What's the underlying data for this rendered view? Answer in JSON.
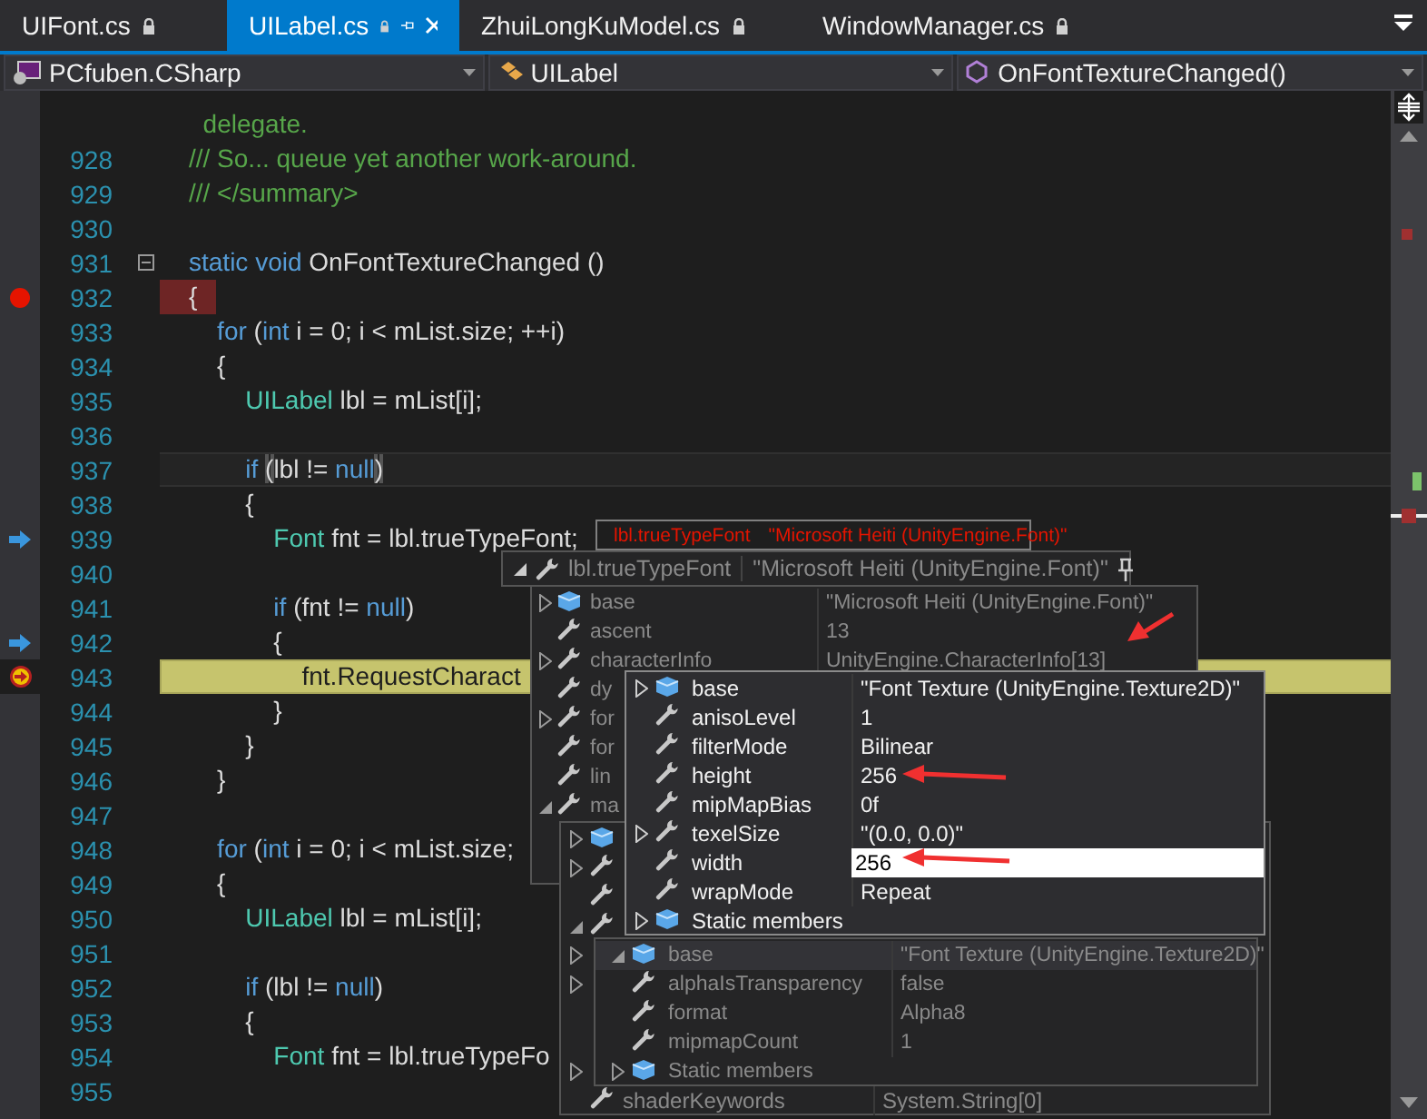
{
  "tabs": [
    {
      "label": "UIFont.cs",
      "selected": false,
      "locked": true
    },
    {
      "label": "UILabel.cs",
      "selected": true,
      "locked": true
    },
    {
      "label": "ZhuiLongKuModel.cs",
      "selected": false,
      "locked": true
    },
    {
      "label": "WindowManager.cs",
      "selected": false,
      "locked": true
    }
  ],
  "nav": {
    "project": "PCfuben.CSharp",
    "type": "UILabel",
    "member": "OnFontTextureChanged()"
  },
  "code_lines": [
    {
      "tokens": [
        {
          "kind": "comment",
          "text": "  delegate."
        }
      ]
    },
    {
      "number": "928",
      "tokens": [
        {
          "kind": "comment",
          "text": "/// So... queue yet another work-around."
        }
      ]
    },
    {
      "number": "929",
      "tokens": [
        {
          "kind": "comment",
          "text": "/// </summary>"
        }
      ]
    },
    {
      "number": "930"
    },
    {
      "number": "931",
      "collapsible": true,
      "tokens": [
        {
          "kind": "keyword",
          "text": "static void "
        },
        {
          "kind": "plain",
          "text": "OnFontTextureChanged ()"
        }
      ]
    },
    {
      "number": "932",
      "breakpoint": true,
      "tokens": [
        {
          "kind": "plain",
          "text": "{"
        }
      ]
    },
    {
      "number": "933",
      "tokens": [
        {
          "kind": "keyword",
          "text": "    for"
        },
        {
          "kind": "plain",
          "text": " ("
        },
        {
          "kind": "keyword",
          "text": "int"
        },
        {
          "kind": "plain",
          "text": " i = 0; i < mList.size; ++i)"
        }
      ]
    },
    {
      "number": "934",
      "tokens": [
        {
          "kind": "plain",
          "text": "    {"
        }
      ]
    },
    {
      "number": "935",
      "tokens": [
        {
          "kind": "type",
          "text": "        UILabel"
        },
        {
          "kind": "plain",
          "text": " lbl = mList[i];"
        }
      ]
    },
    {
      "number": "936"
    },
    {
      "number": "937",
      "caret_line": true,
      "tokens": [
        {
          "kind": "keyword",
          "text": "        if "
        },
        {
          "kind": "match",
          "text": "("
        },
        {
          "kind": "plain",
          "text": "lbl != "
        },
        {
          "kind": "keyword",
          "text": "null"
        },
        {
          "kind": "match",
          "text": ")"
        }
      ]
    },
    {
      "number": "938",
      "tokens": [
        {
          "kind": "plain",
          "text": "        {"
        }
      ]
    },
    {
      "number": "939",
      "call_marker": true,
      "tokens": [
        {
          "kind": "type",
          "text": "            Font"
        },
        {
          "kind": "plain",
          "text": " fnt = lbl.trueTypeFont;"
        }
      ]
    },
    {
      "number": "940"
    },
    {
      "number": "941",
      "tokens": [
        {
          "kind": "keyword",
          "text": "            if"
        },
        {
          "kind": "plain",
          "text": " (fnt != "
        },
        {
          "kind": "keyword",
          "text": "null"
        },
        {
          "kind": "plain",
          "text": ")"
        }
      ]
    },
    {
      "number": "942",
      "call_marker": true,
      "tokens": [
        {
          "kind": "plain",
          "text": "            {"
        }
      ]
    },
    {
      "number": "943",
      "current_statement": true,
      "tokens": [
        {
          "kind": "plain",
          "text": "                fnt.RequestCharact"
        }
      ]
    },
    {
      "number": "944",
      "tokens": [
        {
          "kind": "plain",
          "text": "            }"
        }
      ]
    },
    {
      "number": "945",
      "tokens": [
        {
          "kind": "plain",
          "text": "        }"
        }
      ]
    },
    {
      "number": "946",
      "tokens": [
        {
          "kind": "plain",
          "text": "    }"
        }
      ]
    },
    {
      "number": "947"
    },
    {
      "number": "948",
      "tokens": [
        {
          "kind": "keyword",
          "text": "    for"
        },
        {
          "kind": "plain",
          "text": " ("
        },
        {
          "kind": "keyword",
          "text": "int"
        },
        {
          "kind": "plain",
          "text": " i = 0; i < mList.size;"
        }
      ]
    },
    {
      "number": "949",
      "tokens": [
        {
          "kind": "plain",
          "text": "    {"
        }
      ]
    },
    {
      "number": "950",
      "tokens": [
        {
          "kind": "type",
          "text": "        UILabel"
        },
        {
          "kind": "plain",
          "text": " lbl = mList[i];"
        }
      ]
    },
    {
      "number": "951"
    },
    {
      "number": "952",
      "tokens": [
        {
          "kind": "keyword",
          "text": "        if"
        },
        {
          "kind": "plain",
          "text": " (lbl != "
        },
        {
          "kind": "keyword",
          "text": "null"
        },
        {
          "kind": "plain",
          "text": ")"
        }
      ]
    },
    {
      "number": "953",
      "tokens": [
        {
          "kind": "plain",
          "text": "        {"
        }
      ]
    },
    {
      "number": "954",
      "tokens": [
        {
          "kind": "type",
          "text": "            Font"
        },
        {
          "kind": "plain",
          "text": " fnt = lbl.trueTypeFo"
        }
      ]
    },
    {
      "number": "955"
    }
  ],
  "quick_tip": {
    "expression": "lbl.trueTypeFont",
    "value": "\"Microsoft Heiti (UnityEngine.Font)\""
  },
  "datatip": {
    "expression": "lbl.trueTypeFont",
    "value": "\"Microsoft Heiti (UnityEngine.Font)\"",
    "expanded": true,
    "members": [
      {
        "kind": "object",
        "expandable": true,
        "name": "base",
        "value": "\"Microsoft Heiti (UnityEngine.Font)\""
      },
      {
        "kind": "property",
        "name": "ascent",
        "value": "13"
      },
      {
        "kind": "property",
        "expandable": true,
        "name": "characterInfo",
        "value": "UnityEngine.CharacterInfo[13]"
      },
      {
        "kind": "property",
        "name": "dy"
      },
      {
        "kind": "property",
        "expandable": true,
        "name": "for"
      },
      {
        "kind": "property",
        "name": "for"
      },
      {
        "kind": "property",
        "name": "lin"
      },
      {
        "kind": "property",
        "expanded": true,
        "name": "ma"
      }
    ]
  },
  "material_members": [
    {
      "kind": "object",
      "expandable": true
    },
    {
      "kind": "property",
      "expandable": true
    },
    {
      "kind": "property"
    },
    {
      "kind": "property",
      "expanded": true
    },
    {
      "expandable": true
    },
    {
      "expandable": true
    },
    {
      "expandable": true
    },
    {
      "kind": "property",
      "name": "shaderKeywords",
      "value": "System.String[0]"
    }
  ],
  "texture_members": [
    {
      "kind": "object",
      "expandable": true,
      "name": "base",
      "value": "\"Font Texture (UnityEngine.Texture2D)\""
    },
    {
      "kind": "property",
      "name": "anisoLevel",
      "value": "1"
    },
    {
      "kind": "property",
      "name": "filterMode",
      "value": "Bilinear"
    },
    {
      "kind": "property",
      "name": "height",
      "value": "256"
    },
    {
      "kind": "property",
      "name": "mipMapBias",
      "value": "0f"
    },
    {
      "kind": "property",
      "expandable": true,
      "name": "texelSize",
      "value": "\"(0.0, 0.0)\""
    },
    {
      "kind": "property",
      "name": "width",
      "value": "256",
      "editing": true
    },
    {
      "kind": "property",
      "name": "wrapMode",
      "value": "Repeat"
    },
    {
      "kind": "object",
      "expandable": true,
      "name": "Static members"
    }
  ],
  "base_members": [
    {
      "kind": "object",
      "expanded": true,
      "selected": true,
      "name": "base",
      "value": "\"Font Texture (UnityEngine.Texture2D)\""
    },
    {
      "kind": "property",
      "selected": false,
      "name": "alphaIsTransparency",
      "value": "false"
    },
    {
      "kind": "property",
      "selected": false,
      "name": "format",
      "value": "Alpha8"
    },
    {
      "kind": "property",
      "selected": false,
      "name": "mipmapCount",
      "value": "1"
    },
    {
      "kind": "object",
      "selected": false,
      "expandable": true,
      "name": "Static members"
    }
  ]
}
